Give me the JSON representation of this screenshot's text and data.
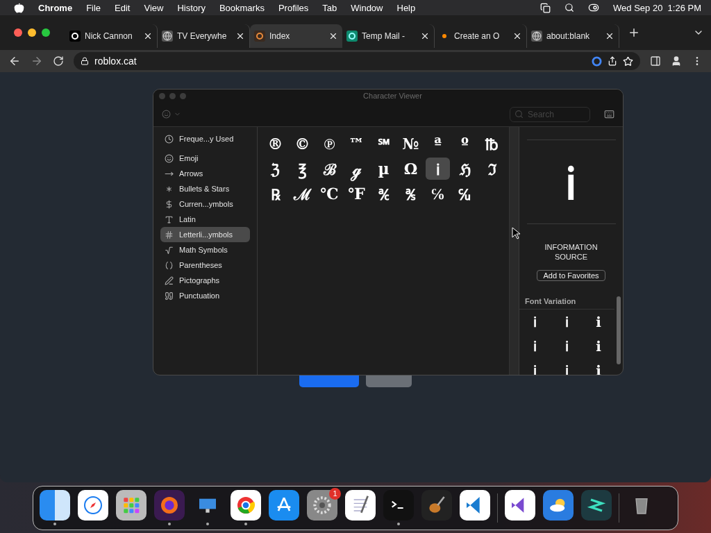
{
  "menu_bar": {
    "app": "Chrome",
    "items": [
      "File",
      "Edit",
      "View",
      "History",
      "Bookmarks",
      "Profiles",
      "Tab",
      "Window",
      "Help"
    ],
    "clock": "Wed Sep 20  1:26 PM"
  },
  "tabs": [
    {
      "title": "Nick Cannon",
      "selected": false
    },
    {
      "title": "TV Everywhe",
      "selected": false
    },
    {
      "title": "Index",
      "selected": true
    },
    {
      "title": "Temp Mail -",
      "selected": false
    },
    {
      "title": "Create an O",
      "selected": false
    },
    {
      "title": "about:blank",
      "selected": false
    }
  ],
  "address_bar": {
    "url": "roblox.cat"
  },
  "character_viewer": {
    "title": "Character Viewer",
    "search": {
      "placeholder": "Search"
    },
    "categories": [
      {
        "label": "Freque...y Used",
        "selected": false
      },
      {
        "label": "Emoji",
        "selected": false
      },
      {
        "label": "Arrows",
        "selected": false
      },
      {
        "label": "Bullets & Stars",
        "selected": false
      },
      {
        "label": "Curren...ymbols",
        "selected": false
      },
      {
        "label": "Latin",
        "selected": false
      },
      {
        "label": "Letterli...ymbols",
        "selected": true
      },
      {
        "label": "Math Symbols",
        "selected": false
      },
      {
        "label": "Parentheses",
        "selected": false
      },
      {
        "label": "Pictographs",
        "selected": false
      },
      {
        "label": "Punctuation",
        "selected": false
      }
    ],
    "characters": [
      {
        "char": "®",
        "selected": false
      },
      {
        "char": "©",
        "selected": false
      },
      {
        "char": "℗",
        "selected": false
      },
      {
        "char": "™",
        "selected": false
      },
      {
        "char": "℠",
        "selected": false
      },
      {
        "char": "№",
        "selected": false
      },
      {
        "char": "ª",
        "selected": false
      },
      {
        "char": "º",
        "selected": false
      },
      {
        "char": "℔",
        "selected": false
      },
      {
        "char": "ℨ",
        "selected": false
      },
      {
        "char": "℥",
        "selected": false
      },
      {
        "char": "ℬ",
        "selected": false
      },
      {
        "char": "ℊ",
        "selected": false
      },
      {
        "char": "µ",
        "selected": false
      },
      {
        "char": "Ω",
        "selected": false
      },
      {
        "char": "ℹ",
        "selected": true
      },
      {
        "char": "ℌ",
        "selected": false
      },
      {
        "char": "ℑ",
        "selected": false
      },
      {
        "char": "℞",
        "selected": false
      },
      {
        "char": "ℳ",
        "selected": false
      },
      {
        "char": "℃",
        "selected": false
      },
      {
        "char": "℉",
        "selected": false
      },
      {
        "char": "℀",
        "selected": false
      },
      {
        "char": "℁",
        "selected": false
      },
      {
        "char": "℅",
        "selected": false
      },
      {
        "char": "℆",
        "selected": false
      }
    ],
    "preview": {
      "char": "ℹ",
      "name": "INFORMATION SOURCE",
      "favorite_button": "Add to Favorites",
      "font_variation_heading": "Font Variation",
      "variations": [
        "ℹ",
        "ℹ",
        "ℹ",
        "ℹ",
        "ℹ",
        "ℹ",
        "ℹ",
        "ℹ",
        "ℹ"
      ]
    }
  },
  "dock": {
    "groups": [
      [
        {
          "running": true
        },
        {
          "running": false
        },
        {
          "running": false
        },
        {
          "running": true
        },
        {
          "running": true
        },
        {
          "running": true
        },
        {
          "running": false
        },
        {
          "running": false,
          "badge": "1"
        },
        {
          "running": false
        },
        {
          "running": true
        },
        {
          "running": false
        },
        {
          "running": false
        }
      ],
      [
        {
          "running": false
        },
        {
          "running": false
        },
        {
          "running": false
        }
      ],
      [
        {
          "running": false
        }
      ]
    ]
  }
}
